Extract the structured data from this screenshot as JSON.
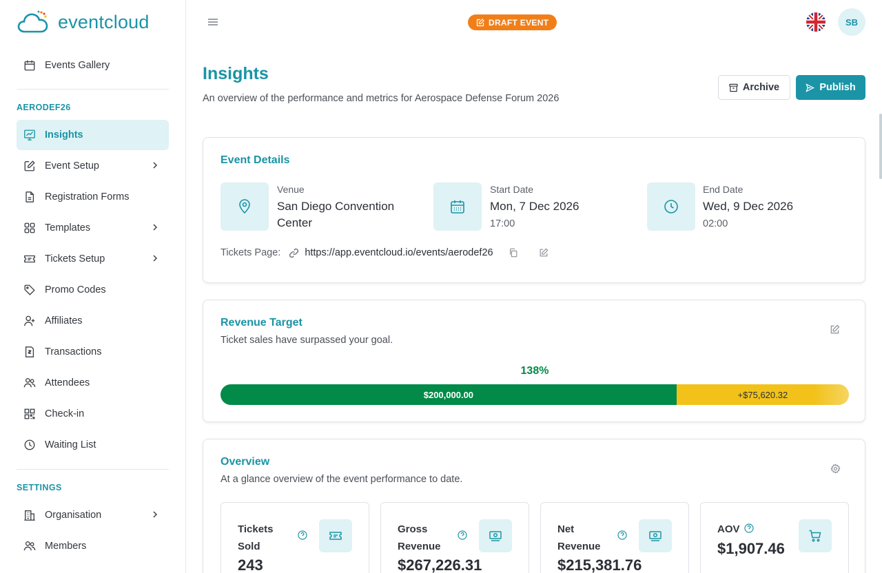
{
  "brand": {
    "name": "eventcloud"
  },
  "topbar": {
    "status_badge": "DRAFT EVENT",
    "avatar_initials": "SB",
    "language": "English (UK)"
  },
  "sidebar": {
    "top_item": {
      "label": "Events Gallery",
      "icon": "calendar-icon"
    },
    "event_section": "AERODEF26",
    "items": [
      {
        "label": "Insights",
        "icon": "chart-icon",
        "active": true
      },
      {
        "label": "Event Setup",
        "icon": "edit-icon",
        "has_submenu": true
      },
      {
        "label": "Registration Forms",
        "icon": "document-icon"
      },
      {
        "label": "Templates",
        "icon": "grid-icon",
        "has_submenu": true
      },
      {
        "label": "Tickets Setup",
        "icon": "ticket-icon",
        "has_submenu": true
      },
      {
        "label": "Promo Codes",
        "icon": "tag-icon"
      },
      {
        "label": "Affiliates",
        "icon": "user-plus-icon"
      },
      {
        "label": "Transactions",
        "icon": "receipt-icon"
      },
      {
        "label": "Attendees",
        "icon": "users-icon"
      },
      {
        "label": "Check-in",
        "icon": "qr-icon"
      },
      {
        "label": "Waiting List",
        "icon": "clock-icon"
      }
    ],
    "settings_section": "SETTINGS",
    "settings_items": [
      {
        "label": "Organisation",
        "icon": "building-icon",
        "has_submenu": true
      },
      {
        "label": "Members",
        "icon": "users-icon"
      }
    ]
  },
  "header": {
    "title": "Insights",
    "subtitle": "An overview of the performance and metrics for Aerospace Defense Forum 2026",
    "archive_label": "Archive",
    "publish_label": "Publish"
  },
  "event_details": {
    "title": "Event Details",
    "venue_label": "Venue",
    "venue_value": "San Diego Convention Center",
    "start_label": "Start Date",
    "start_date": "Mon, 7 Dec 2026",
    "start_time": "17:00",
    "end_label": "End Date",
    "end_date": "Wed, 9 Dec 2026",
    "end_time": "02:00",
    "tickets_page_label": "Tickets Page:",
    "tickets_page_url": "https://app.eventcloud.io/events/aerodef26"
  },
  "revenue_target": {
    "title": "Revenue Target",
    "subtitle": "Ticket sales have surpassed your goal.",
    "percent_label": "138%",
    "target_label": "$200,000.00",
    "target_value": 200000,
    "excess_label": "+$75,620.32",
    "excess_value": 75620.32
  },
  "overview": {
    "title": "Overview",
    "subtitle": "At a glance overview of the event performance to date.",
    "stats": [
      {
        "label": "Tickets Sold",
        "value": "243",
        "icon": "ticket-icon"
      },
      {
        "label": "Gross Revenue",
        "value": "$267,226.31",
        "icon": "money-icon"
      },
      {
        "label": "Net Revenue",
        "value": "$215,381.76",
        "icon": "money-icon"
      },
      {
        "label": "AOV",
        "value": "$1,907.46",
        "icon": "cart-icon"
      }
    ]
  },
  "colors": {
    "accent": "#1a94a6",
    "accent_light": "#dff2f5",
    "draft": "#f07f1a",
    "success": "#018a48",
    "warning": "#f2c21b"
  }
}
